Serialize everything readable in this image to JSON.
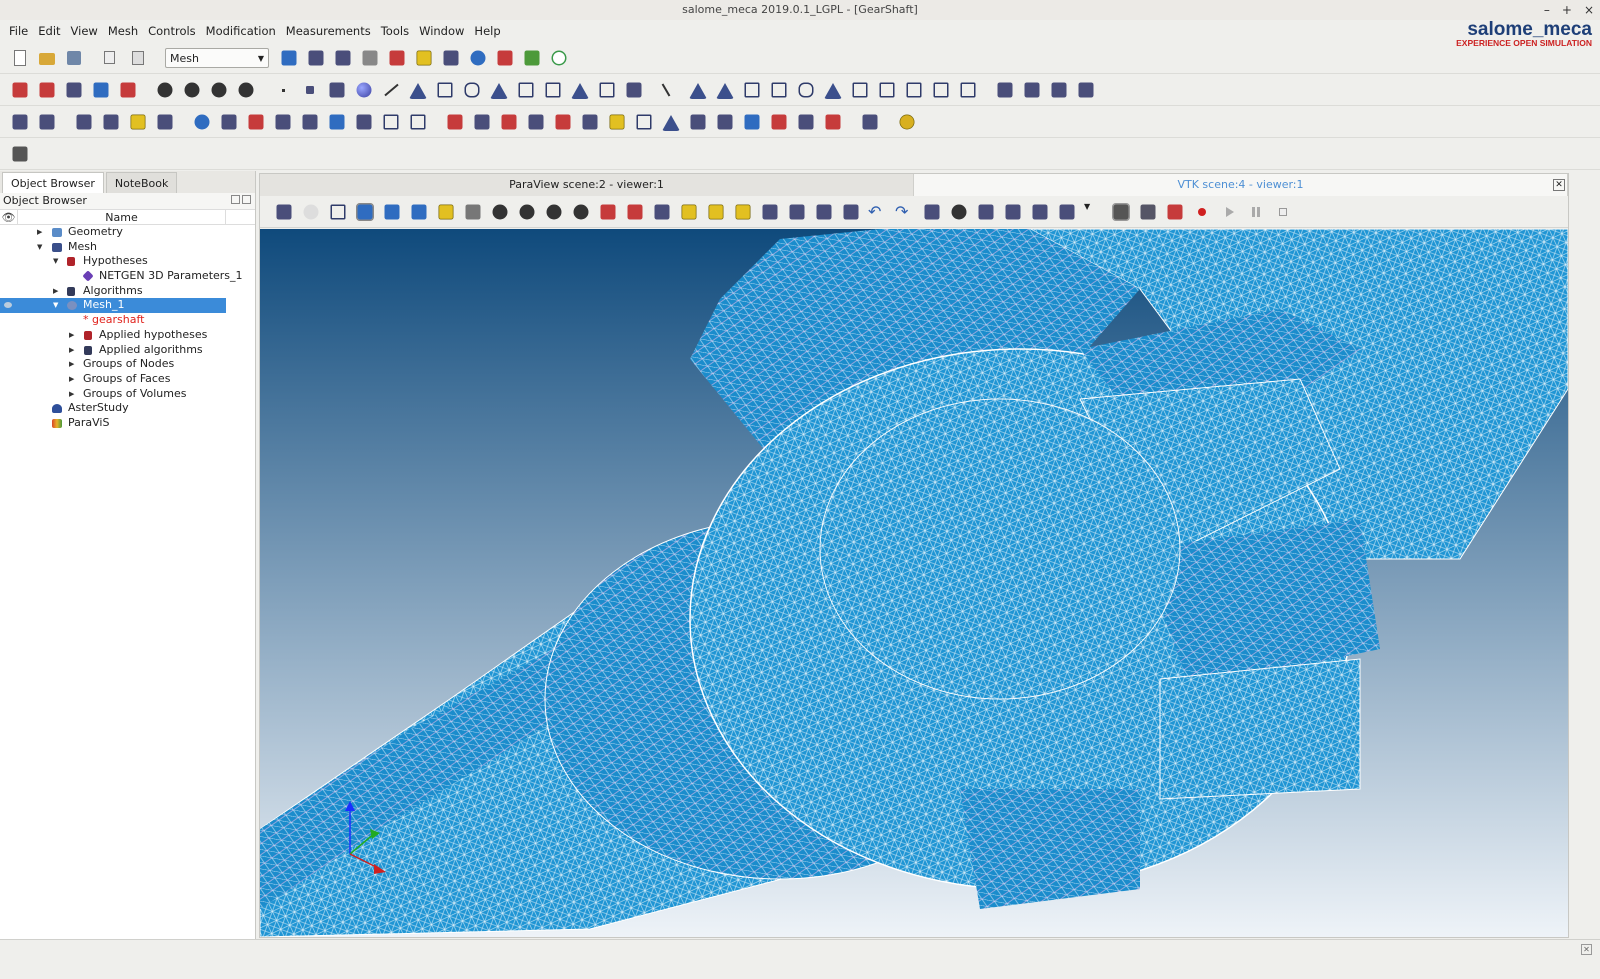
{
  "window": {
    "title": "salome_meca 2019.0.1_LGPL - [GearShaft]"
  },
  "menu": [
    "File",
    "Edit",
    "View",
    "Mesh",
    "Controls",
    "Modification",
    "Measurements",
    "Tools",
    "Window",
    "Help"
  ],
  "logo": {
    "name": "salome_meca",
    "tagline": "EXPERIENCE OPEN SIMULATION"
  },
  "toolbar": {
    "module_combo": "Mesh"
  },
  "left_panel": {
    "tabs": [
      "Object Browser",
      "NoteBook"
    ],
    "header": "Object Browser",
    "column_name": "Name",
    "column_eye": "👁",
    "tree": [
      {
        "label": "Geometry",
        "arrow": "▶",
        "icon_color": "#5a8cc8"
      },
      {
        "label": "Mesh",
        "arrow": "▼",
        "icon_color": "#3a4f8a"
      },
      {
        "label": "Hypotheses",
        "arrow": "▼",
        "icon_color": "#b0232a"
      },
      {
        "label": "NETGEN 3D Parameters_1",
        "arrow": "",
        "icon_color": "#6a3fb5"
      },
      {
        "label": "Algorithms",
        "arrow": "▶",
        "icon_color": "#333a5a"
      },
      {
        "label": "Mesh_1",
        "arrow": "▼",
        "icon_color": "#7a90c0"
      },
      {
        "label": "* gearshaft",
        "arrow": "",
        "icon_color": ""
      },
      {
        "label": "Applied hypotheses",
        "arrow": "▶",
        "icon_color": "#b0232a"
      },
      {
        "label": "Applied algorithms",
        "arrow": "▶",
        "icon_color": "#333a5a"
      },
      {
        "label": "Groups of Nodes",
        "arrow": "▶",
        "icon_color": ""
      },
      {
        "label": "Groups of Faces",
        "arrow": "▶",
        "icon_color": ""
      },
      {
        "label": "Groups of Volumes",
        "arrow": "▶",
        "icon_color": ""
      },
      {
        "label": "AsterStudy",
        "arrow": "",
        "icon_color": "#2e4f9a"
      },
      {
        "label": "ParaViS",
        "arrow": "",
        "icon_color": "#d9462a"
      }
    ]
  },
  "viewer": {
    "tabs": [
      "ParaView scene:2 - viewer:1",
      "VTK scene:4 - viewer:1"
    ],
    "close": "✕",
    "mesh_color": "#2294d2"
  },
  "status": {
    "corner": "✕"
  }
}
